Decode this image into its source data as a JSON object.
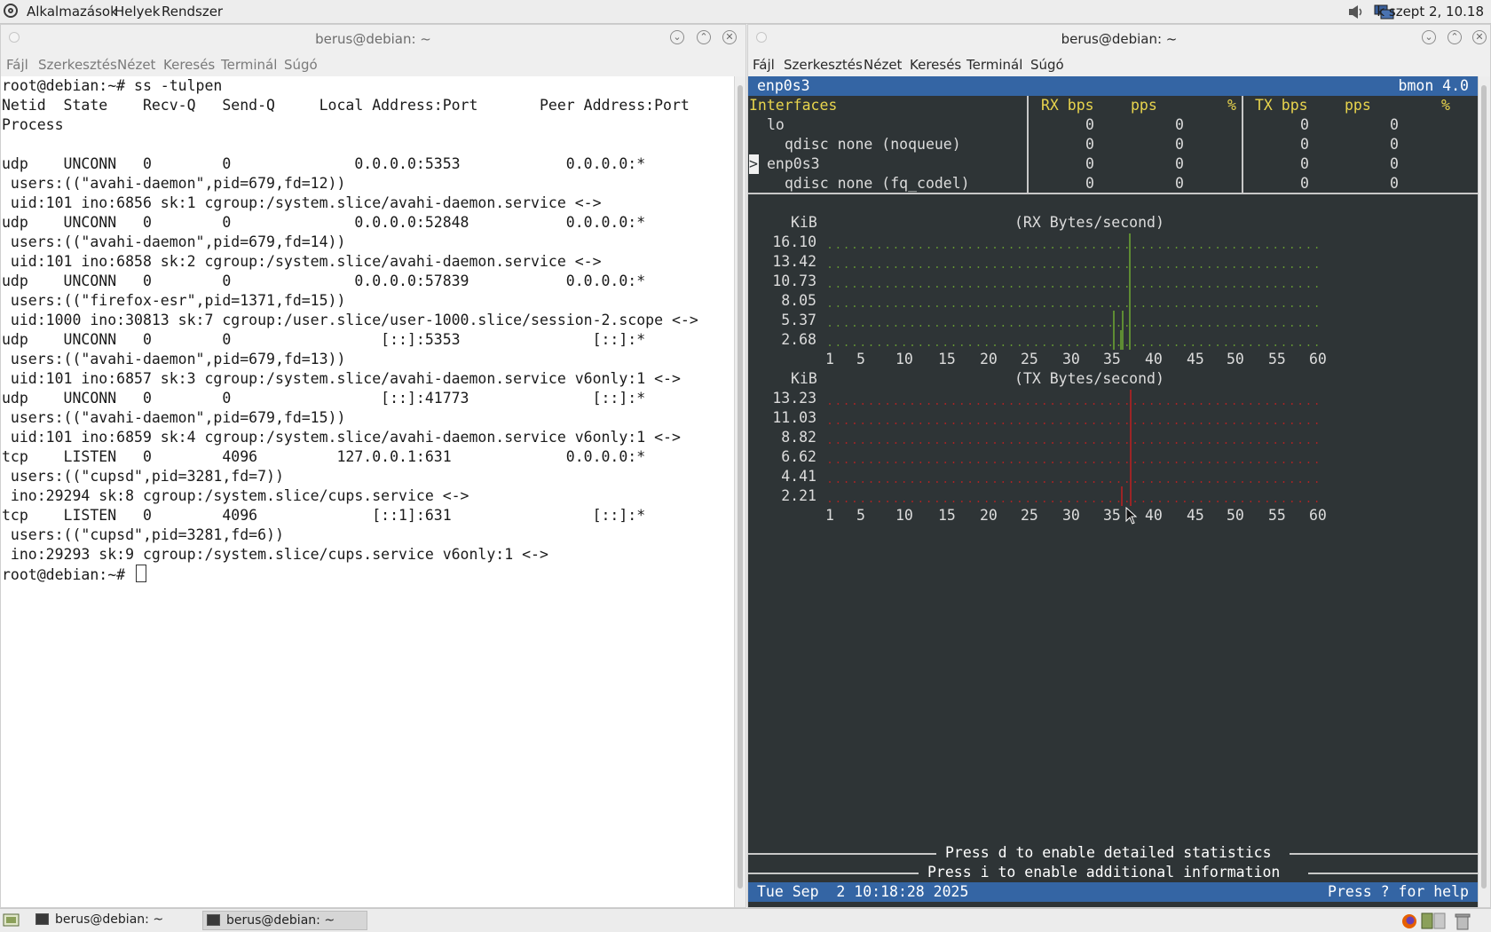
{
  "top_panel": {
    "menus": [
      "Alkalmazások",
      "Helyek",
      "Rendszer"
    ],
    "clock": "k szept 2, 10.18"
  },
  "windows": {
    "title": "berus@debian: ~",
    "menu": [
      "Fájl",
      "Szerkesztés",
      "Nézet",
      "Keresés",
      "Terminál",
      "Súgó"
    ]
  },
  "terminal_left": {
    "lines": [
      "root@debian:~# ss -tulpen",
      "Netid  State    Recv-Q   Send-Q     Local Address:Port       Peer Address:Port",
      "Process",
      "",
      "udp    UNCONN   0        0              0.0.0.0:5353            0.0.0.0:*",
      " users:((\"avahi-daemon\",pid=679,fd=12))",
      " uid:101 ino:6856 sk:1 cgroup:/system.slice/avahi-daemon.service <->",
      "udp    UNCONN   0        0              0.0.0.0:52848           0.0.0.0:*",
      " users:((\"avahi-daemon\",pid=679,fd=14))",
      " uid:101 ino:6858 sk:2 cgroup:/system.slice/avahi-daemon.service <->",
      "udp    UNCONN   0        0              0.0.0.0:57839           0.0.0.0:*",
      " users:((\"firefox-esr\",pid=1371,fd=15))",
      " uid:1000 ino:30813 sk:7 cgroup:/user.slice/user-1000.slice/session-2.scope <->",
      "udp    UNCONN   0        0                 [::]:5353               [::]:*",
      " users:((\"avahi-daemon\",pid=679,fd=13))",
      " uid:101 ino:6857 sk:3 cgroup:/system.slice/avahi-daemon.service v6only:1 <->",
      "udp    UNCONN   0        0                 [::]:41773              [::]:*",
      " users:((\"avahi-daemon\",pid=679,fd=15))",
      " uid:101 ino:6859 sk:4 cgroup:/system.slice/avahi-daemon.service v6only:1 <->",
      "tcp    LISTEN   0        4096         127.0.0.1:631             0.0.0.0:*",
      " users:((\"cupsd\",pid=3281,fd=7))",
      " ino:29294 sk:8 cgroup:/system.slice/cups.service <->",
      "tcp    LISTEN   0        4096             [::1]:631                [::]:*",
      " users:((\"cupsd\",pid=3281,fd=6))",
      " ino:29293 sk:9 cgroup:/system.slice/cups.service v6only:1 <->"
    ],
    "prompt": "root@debian:~# "
  },
  "bmon": {
    "header_left": "enp0s3",
    "header_right": "bmon 4.0",
    "columns": [
      "Interfaces",
      "RX bps",
      "pps",
      "%",
      "TX bps",
      "pps",
      "%"
    ],
    "rows": [
      {
        "name": "lo",
        "rx_bps": "0",
        "rx_pps": "0",
        "tx_bps": "0",
        "tx_pps": "0"
      },
      {
        "name": "qdisc none (noqueue)",
        "rx_bps": "0",
        "rx_pps": "0",
        "tx_bps": "0",
        "tx_pps": "0"
      },
      {
        "name": "enp0s3",
        "rx_bps": "0",
        "rx_pps": "0",
        "tx_bps": "0",
        "tx_pps": "0",
        "selected": true
      },
      {
        "name": "qdisc none (fq_codel)",
        "rx_bps": "0",
        "rx_pps": "0",
        "tx_bps": "0",
        "tx_pps": "0"
      }
    ],
    "selection_marker": ">",
    "rx_graph": {
      "unit": "KiB",
      "title": "(RX Bytes/second)",
      "y_labels": [
        "16.10",
        "13.42",
        "10.73",
        "8.05",
        "5.37",
        "2.68"
      ],
      "x_labels": [
        "1",
        "5",
        "10",
        "15",
        "20",
        "25",
        "30",
        "35",
        "40",
        "45",
        "50",
        "55",
        "60"
      ],
      "color": "#73b132"
    },
    "tx_graph": {
      "unit": "KiB",
      "title": "(TX Bytes/second)",
      "y_labels": [
        "13.23",
        "11.03",
        "8.82",
        "6.62",
        "4.41",
        "2.21"
      ],
      "x_labels": [
        "1",
        "5",
        "10",
        "15",
        "20",
        "25",
        "30",
        "35",
        "40",
        "45",
        "50",
        "55",
        "60"
      ],
      "color": "#cc1f1f"
    },
    "hint_detailed": "Press d to enable detailed statistics",
    "hint_info": "Press i to enable additional information",
    "status_left": "Tue Sep  2 10:18:28 2025",
    "status_right": "Press ? for help"
  },
  "taskbar": {
    "items": [
      "berus@debian: ~",
      "berus@debian: ~"
    ]
  }
}
